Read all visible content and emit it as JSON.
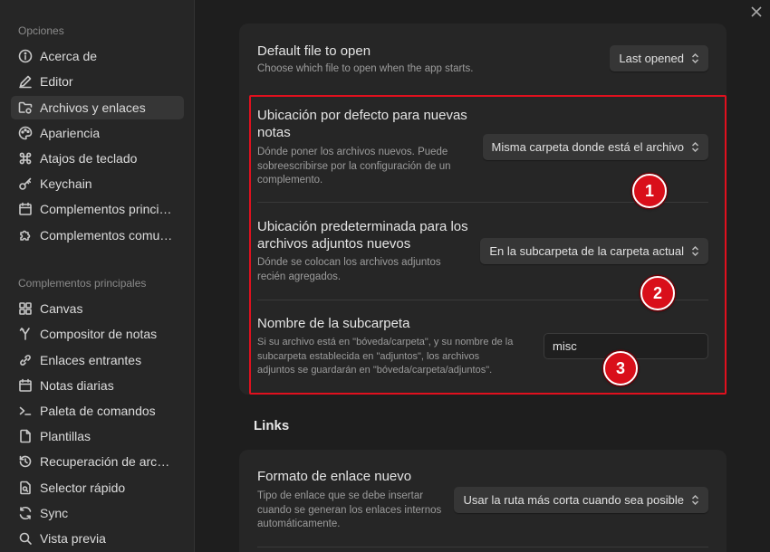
{
  "sidebar": {
    "options_title": "Opciones",
    "options": [
      {
        "label": "Acerca de",
        "icon": "info-icon"
      },
      {
        "label": "Editor",
        "icon": "pencil-icon"
      },
      {
        "label": "Archivos y enlaces",
        "icon": "folder-cog-icon",
        "active": true
      },
      {
        "label": "Apariencia",
        "icon": "palette-icon"
      },
      {
        "label": "Atajos de teclado",
        "icon": "command-icon"
      },
      {
        "label": "Keychain",
        "icon": "key-icon"
      },
      {
        "label": "Complementos princi…",
        "icon": "calendar-icon"
      },
      {
        "label": "Complementos comu…",
        "icon": "puzzle-icon"
      }
    ],
    "core_title": "Complementos principales",
    "core": [
      {
        "label": "Canvas",
        "icon": "grid-icon"
      },
      {
        "label": "Compositor de notas",
        "icon": "merge-icon"
      },
      {
        "label": "Enlaces entrantes",
        "icon": "link-in-icon"
      },
      {
        "label": "Notas diarias",
        "icon": "calendar-icon"
      },
      {
        "label": "Paleta de comandos",
        "icon": "terminal-icon"
      },
      {
        "label": "Plantillas",
        "icon": "file-icon"
      },
      {
        "label": "Recuperación de archi…",
        "icon": "history-icon"
      },
      {
        "label": "Selector rápido",
        "icon": "file-search-icon"
      },
      {
        "label": "Sync",
        "icon": "refresh-icon"
      },
      {
        "label": "Vista previa",
        "icon": "search-icon"
      }
    ]
  },
  "main": {
    "default_file": {
      "name": "Default file to open",
      "desc": "Choose which file to open when the app starts.",
      "value": "Last opened"
    },
    "new_note_location": {
      "name_line1": "Ubicación por defecto para nuevas",
      "name_line2": "notas",
      "desc_line1": "Dónde poner los archivos nuevos. Puede",
      "desc_line2": "sobreescribirse por la configuración de un",
      "desc_line3": "complemento.",
      "value": "Misma carpeta donde está el archivo"
    },
    "attachment_location": {
      "name_line1": "Ubicación predeterminada para los",
      "name_line2": "archivos adjuntos nuevos",
      "desc_line1": "Dónde se colocan los archivos adjuntos",
      "desc_line2": "recién agregados.",
      "value": "En la subcarpeta de la carpeta actual"
    },
    "subfolder_name": {
      "name": "Nombre de la subcarpeta",
      "desc_line1": "Si su archivo está en \"bóveda/carpeta\", y su nombre de la",
      "desc_line2": "subcarpeta establecida en \"adjuntos\", los archivos",
      "desc_line3": "adjuntos se guardarán en \"bóveda/carpeta/adjuntos\".",
      "value": "misc"
    },
    "links_heading": "Links",
    "new_link_format": {
      "name": "Formato de enlace nuevo",
      "desc_line1": "Tipo de enlace que se debe insertar",
      "desc_line2": "cuando se generan los enlaces internos",
      "desc_line3": "automáticamente.",
      "value": "Usar la ruta más corta cuando sea posible"
    }
  },
  "annotations": {
    "markers": [
      "1",
      "2",
      "3"
    ],
    "highlight_color": "#e0101e",
    "marker_color": "#d90f1a"
  }
}
